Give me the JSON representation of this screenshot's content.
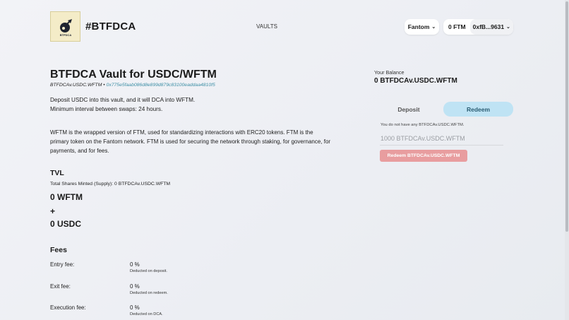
{
  "header": {
    "brand": "#BTFDCA",
    "logo_text": "BTFDCA",
    "nav_vaults": "VAULTS",
    "network": "Fantom",
    "wallet_balance": "0 FTM",
    "wallet_address": "0xfB...9631"
  },
  "vault": {
    "title": "BTFDCA Vault for USDC/WFTM",
    "token_symbol": "BTFDCAv.USDC.WFTM",
    "separator": "•",
    "contract_address": "0x775e5faab086d8e899d879c83100eaddaa4810f5",
    "desc_line1": "Deposit USDC into this vault, and it will DCA into WFTM.",
    "desc_line2": "Minimum interval between swaps: 24 hours.",
    "paragraph": "WFTM is the wrapped version of FTM, used for standardizing interactions with ERC20 tokens. FTM is the primary token on the Fantom network. FTM is used for securing the network through staking, for governance, for payments, and for fees."
  },
  "tvl": {
    "heading": "TVL",
    "supply": "Total Shares Minted (Supply): 0 BTFDCAv.USDC.WFTM",
    "amount1": "0 WFTM",
    "plus": "+",
    "amount2": "0 USDC"
  },
  "fees": {
    "heading": "Fees",
    "items": [
      {
        "label": "Entry fee:",
        "value": "0 %",
        "note": "Deducted on deposit."
      },
      {
        "label": "Exit fee:",
        "value": "0 %",
        "note": "Deducted on redeem."
      },
      {
        "label": "Execution fee:",
        "value": "0 %",
        "note": "Deducted on DCA."
      }
    ]
  },
  "panel": {
    "balance_label": "Your Balance",
    "balance_value": "0 BTFDCAv.USDC.WFTM",
    "tab_deposit": "Deposit",
    "tab_redeem": "Redeem",
    "notice": "You do not have any BTFDCAv.USDC.WFTM.",
    "input_placeholder": "1000 BTFDCAv.USDC.WFTM",
    "redeem_button": "Redeem BTFDCAv.USDC.WFTM"
  },
  "colors": {
    "accent": "#bfe3f4",
    "link": "#3e8fa6",
    "button_disabled": "#e89d9f"
  }
}
